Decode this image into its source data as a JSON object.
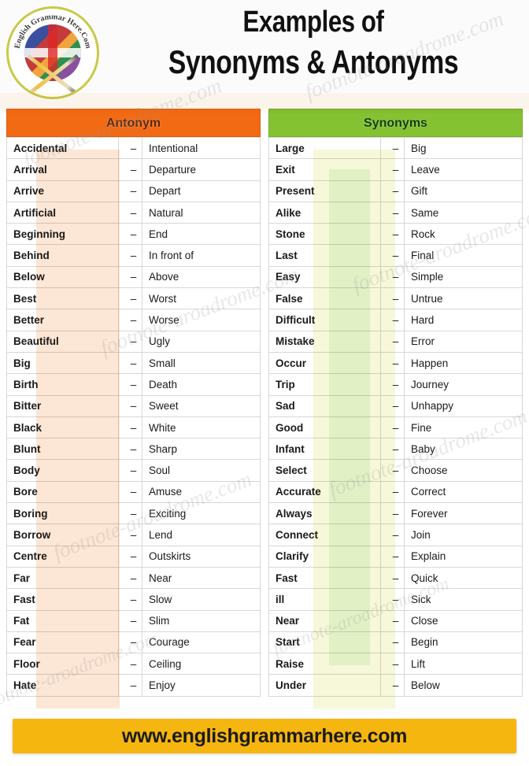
{
  "meta": {
    "title_line1": "Examples of",
    "title_line2": "Synonyms & Antonyms",
    "watermark_text": "footnote-aroadrome.com",
    "colors": {
      "antonym_header_bg": "#f26a14",
      "synonym_header_bg": "#85c232",
      "footer_bg": "#f6b610",
      "antonym_tint": "#fbd7bb",
      "synonym_tint": "#f4f4c9",
      "page_bg": "#ffffff"
    }
  },
  "logo": {
    "ring_text": "English Grammar Here.Com",
    "emblem_name": "union-flag-globe-emblem"
  },
  "antonym_column": {
    "header": "Antonym",
    "separator": "–",
    "rows": [
      {
        "word": "Accidental",
        "pair": "Intentional"
      },
      {
        "word": "Arrival",
        "pair": "Departure"
      },
      {
        "word": "Arrive",
        "pair": "Depart"
      },
      {
        "word": "Artificial",
        "pair": "Natural"
      },
      {
        "word": "Beginning",
        "pair": "End"
      },
      {
        "word": "Behind",
        "pair": "In front of"
      },
      {
        "word": "Below",
        "pair": "Above"
      },
      {
        "word": "Best",
        "pair": "Worst"
      },
      {
        "word": "Better",
        "pair": "Worse"
      },
      {
        "word": "Beautiful",
        "pair": "Ugly"
      },
      {
        "word": "Big",
        "pair": "Small"
      },
      {
        "word": "Birth",
        "pair": "Death"
      },
      {
        "word": "Bitter",
        "pair": "Sweet"
      },
      {
        "word": "Black",
        "pair": "White"
      },
      {
        "word": "Blunt",
        "pair": "Sharp"
      },
      {
        "word": "Body",
        "pair": "Soul"
      },
      {
        "word": "Bore",
        "pair": "Amuse"
      },
      {
        "word": "Boring",
        "pair": "Exciting"
      },
      {
        "word": "Borrow",
        "pair": "Lend"
      },
      {
        "word": "Centre",
        "pair": "Outskirts"
      },
      {
        "word": "Far",
        "pair": "Near"
      },
      {
        "word": "Fast",
        "pair": "Slow"
      },
      {
        "word": "Fat",
        "pair": "Slim"
      },
      {
        "word": "Fear",
        "pair": "Courage"
      },
      {
        "word": "Floor",
        "pair": "Ceiling"
      },
      {
        "word": "Hate",
        "pair": "Enjoy"
      }
    ]
  },
  "synonym_column": {
    "header": "Synonyms",
    "separator": "–",
    "rows": [
      {
        "word": "Large",
        "pair": "Big"
      },
      {
        "word": "Exit",
        "pair": "Leave"
      },
      {
        "word": "Present",
        "pair": "Gift"
      },
      {
        "word": "Alike",
        "pair": "Same"
      },
      {
        "word": "Stone",
        "pair": "Rock"
      },
      {
        "word": "Last",
        "pair": "Final"
      },
      {
        "word": "Easy",
        "pair": "Simple"
      },
      {
        "word": "False",
        "pair": "Untrue"
      },
      {
        "word": "Difficult",
        "pair": "Hard"
      },
      {
        "word": "Mistake",
        "pair": "Error"
      },
      {
        "word": "Occur",
        "pair": "Happen"
      },
      {
        "word": "Trip",
        "pair": "Journey"
      },
      {
        "word": "Sad",
        "pair": "Unhappy"
      },
      {
        "word": "Good",
        "pair": "Fine"
      },
      {
        "word": "Infant",
        "pair": "Baby"
      },
      {
        "word": "Select",
        "pair": "Choose"
      },
      {
        "word": "Accurate",
        "pair": "Correct"
      },
      {
        "word": "Always",
        "pair": "Forever"
      },
      {
        "word": "Connect",
        "pair": "Join"
      },
      {
        "word": "Clarify",
        "pair": "Explain"
      },
      {
        "word": "Fast",
        "pair": "Quick"
      },
      {
        "word": "ill",
        "pair": "Sick"
      },
      {
        "word": "Near",
        "pair": "Close"
      },
      {
        "word": "Start",
        "pair": "Begin"
      },
      {
        "word": "Raise",
        "pair": "Lift"
      },
      {
        "word": "Under",
        "pair": "Below"
      }
    ]
  },
  "footer": {
    "url": "www.englishgrammarhere.com"
  }
}
